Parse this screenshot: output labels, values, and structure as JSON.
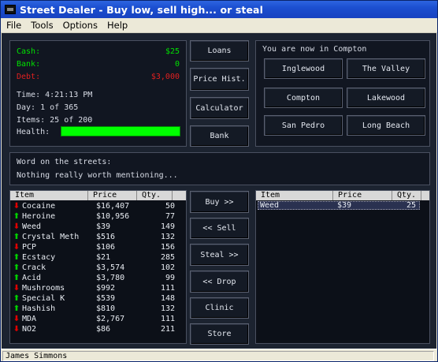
{
  "window": {
    "title": "Street Dealer - Buy low, sell high... or steal"
  },
  "menu": [
    "File",
    "Tools",
    "Options",
    "Help"
  ],
  "stats": {
    "cash_label": "Cash:",
    "cash_value": "$25",
    "bank_label": "Bank:",
    "bank_value": "0",
    "debt_label": "Debt:",
    "debt_value": "$3,000",
    "time": "Time: 4:21:13 PM",
    "day": "Day: 1 of 365",
    "items": "Items: 25 of 200",
    "health_label": "Health:",
    "health_fraction": 1.0
  },
  "side_buttons": [
    "Loans",
    "Price Hist.",
    "Calculator",
    "Bank"
  ],
  "location": {
    "title": "You are now in Compton",
    "places": [
      "Inglewood",
      "The Valley",
      "Compton",
      "Lakewood",
      "San Pedro",
      "Long Beach"
    ]
  },
  "news": {
    "heading": "Word on the streets:",
    "message": "Nothing really worth mentioning..."
  },
  "market": {
    "headers": [
      "Item",
      "Price",
      "Qty."
    ],
    "rows": [
      {
        "trend": "down",
        "item": "Cocaine",
        "price": "$16,407",
        "qty": "50"
      },
      {
        "trend": "up",
        "item": "Heroine",
        "price": "$10,956",
        "qty": "77"
      },
      {
        "trend": "down",
        "item": "Weed",
        "price": "$39",
        "qty": "149"
      },
      {
        "trend": "up",
        "item": "Crystal Meth",
        "price": "$516",
        "qty": "132"
      },
      {
        "trend": "down",
        "item": "PCP",
        "price": "$106",
        "qty": "156"
      },
      {
        "trend": "up",
        "item": "Ecstacy",
        "price": "$21",
        "qty": "285"
      },
      {
        "trend": "up",
        "item": "Crack",
        "price": "$3,574",
        "qty": "102"
      },
      {
        "trend": "up",
        "item": "Acid",
        "price": "$3,780",
        "qty": "99"
      },
      {
        "trend": "down",
        "item": "Mushrooms",
        "price": "$992",
        "qty": "111"
      },
      {
        "trend": "up",
        "item": "Special K",
        "price": "$539",
        "qty": "148"
      },
      {
        "trend": "up",
        "item": "Hashish",
        "price": "$810",
        "qty": "132"
      },
      {
        "trend": "down",
        "item": "MDA",
        "price": "$2,767",
        "qty": "111"
      },
      {
        "trend": "down",
        "item": "NO2",
        "price": "$86",
        "qty": "211"
      }
    ]
  },
  "action_buttons": [
    "Buy >>",
    "<< Sell",
    "Steal >>",
    "<< Drop",
    "Clinic",
    "Store"
  ],
  "inventory": {
    "headers": [
      "Item",
      "Price",
      "Qty."
    ],
    "rows": [
      {
        "item": "Weed",
        "price": "$39",
        "qty": "25"
      }
    ]
  },
  "status": {
    "player": "James Simmons"
  }
}
